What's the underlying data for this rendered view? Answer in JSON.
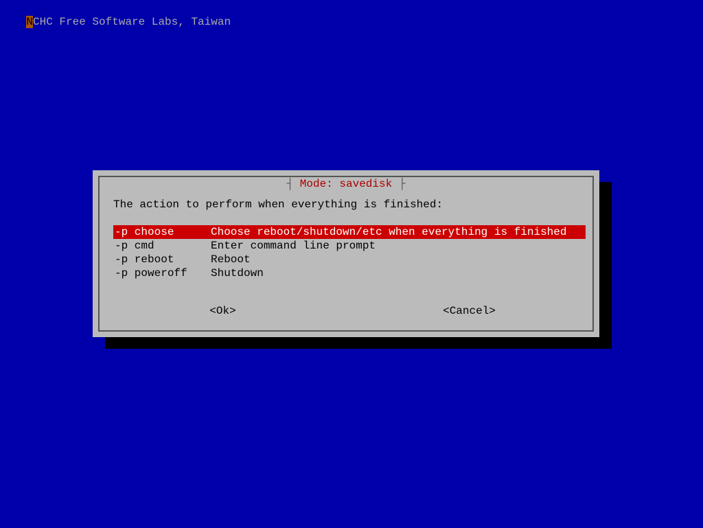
{
  "header": {
    "first_char": "N",
    "rest": "CHC Free Software Labs, Taiwan"
  },
  "dialog": {
    "title_frame_left": "┤ ",
    "title": "Mode: savedisk",
    "title_frame_right": " ├",
    "prompt": "The action to perform when everything is finished:",
    "menu": [
      {
        "opt": "-p choose",
        "desc": "Choose reboot/shutdown/etc when everything is finished",
        "selected": true
      },
      {
        "opt": "-p cmd",
        "desc": "Enter command line prompt",
        "selected": false
      },
      {
        "opt": "-p reboot",
        "desc": "Reboot",
        "selected": false
      },
      {
        "opt": "-p poweroff",
        "desc": "Shutdown",
        "selected": false
      }
    ],
    "buttons": {
      "ok": "<Ok>",
      "cancel": "<Cancel>"
    }
  }
}
